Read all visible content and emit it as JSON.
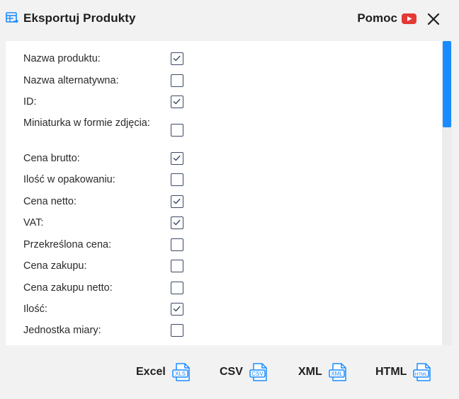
{
  "dialog": {
    "title": "Eksportuj Produkty",
    "help_label": "Pomoc",
    "accent_color": "#1a8cff",
    "youtube_color": "#e53935"
  },
  "fields": [
    {
      "label": "Nazwa produktu:",
      "checked": true
    },
    {
      "label": "Nazwa alternatywna:",
      "checked": false
    },
    {
      "label": "ID:",
      "checked": true
    },
    {
      "label": "Miniaturka w formie zdjęcia:",
      "checked": false
    },
    {
      "label": "Cena brutto:",
      "checked": true
    },
    {
      "label": "Ilość w opakowaniu:",
      "checked": false
    },
    {
      "label": "Cena netto:",
      "checked": true
    },
    {
      "label": "VAT:",
      "checked": true
    },
    {
      "label": "Przekreślona cena:",
      "checked": false
    },
    {
      "label": "Cena zakupu:",
      "checked": false
    },
    {
      "label": "Cena zakupu netto:",
      "checked": false
    },
    {
      "label": "Ilość:",
      "checked": true
    },
    {
      "label": "Jednostka miary:",
      "checked": false
    }
  ],
  "export": [
    {
      "label": "Excel",
      "icon_text": "XLS",
      "icon": "xls-file-icon"
    },
    {
      "label": "CSV",
      "icon_text": "CSV",
      "icon": "csv-file-icon"
    },
    {
      "label": "XML",
      "icon_text": "XML",
      "icon": "xml-file-icon"
    },
    {
      "label": "HTML",
      "icon_text": "HTML",
      "icon": "html-file-icon"
    }
  ]
}
